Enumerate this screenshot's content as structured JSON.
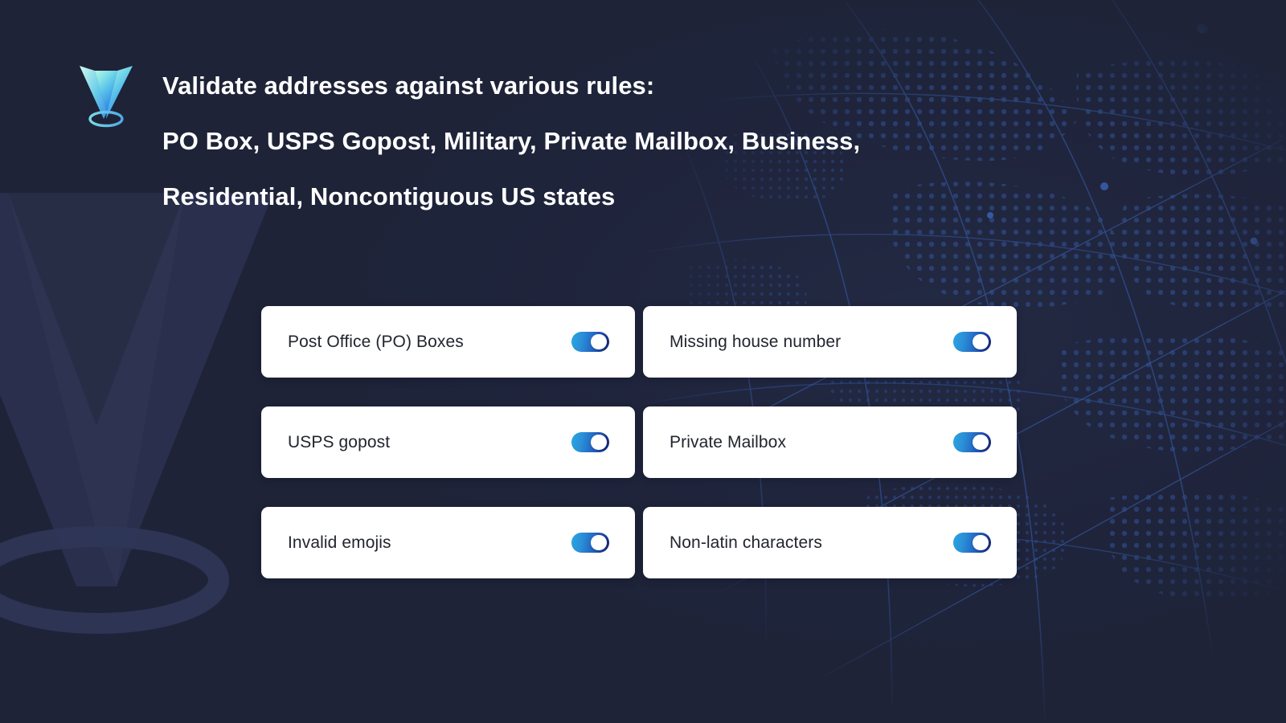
{
  "meta": {
    "background_color": "#1e2337",
    "card_background": "#ffffff",
    "headline_color": "#ffffff",
    "label_color": "#22252e",
    "toggle_gradient_start": "#27a7e0",
    "toggle_gradient_end": "#14206e",
    "toggle_knob_color": "#ffffff",
    "logo_gradient_start": "#aef2e0",
    "logo_gradient_end": "#2f7fe0",
    "globe_dot_color": "#2c4277",
    "globe_line_color": "#2f4d8c",
    "watermark_color": "#2a3048"
  },
  "brand": {
    "logo_icon": "v-pin-location-icon",
    "logo_alt": "V location pin logo"
  },
  "header": {
    "lines": [
      "Validate addresses against various rules:",
      "PO Box, USPS Gopost, Military, Private Mailbox, Business,",
      "Residential, Noncontiguous US states"
    ]
  },
  "rules": [
    {
      "id": "po-boxes",
      "label": "Post Office (PO) Boxes",
      "enabled": true
    },
    {
      "id": "missing-house-no",
      "label": "Missing house number",
      "enabled": true
    },
    {
      "id": "usps-gopost",
      "label": "USPS gopost",
      "enabled": true
    },
    {
      "id": "private-mailbox",
      "label": "Private Mailbox",
      "enabled": true
    },
    {
      "id": "invalid-emojis",
      "label": "Invalid emojis",
      "enabled": true
    },
    {
      "id": "non-latin-chars",
      "label": "Non-latin characters",
      "enabled": true
    }
  ]
}
